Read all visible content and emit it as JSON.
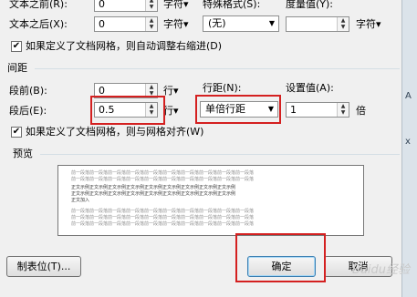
{
  "indent": {
    "before_label": "文本之前(R):",
    "before_value": "0",
    "before_unit": "字符▾",
    "after_label": "文本之后(X):",
    "after_value": "0",
    "after_unit": "字符▾",
    "special_label": "特殊格式(S):",
    "special_value": "(无)",
    "measure_label": "度量值(Y):",
    "measure_unit": "字符▾",
    "auto_adjust_label": "如果定义了文档网格，则自动调整右缩进(D)"
  },
  "spacing": {
    "section_title": "间距",
    "before_label": "段前(B):",
    "before_value": "0",
    "before_unit": "行▾",
    "after_label": "段后(E):",
    "after_value": "0.5",
    "after_unit": "行▾",
    "line_spacing_label": "行距(N):",
    "line_spacing_value": "单倍行距",
    "set_value_label": "设置值(A):",
    "set_value": "1",
    "set_value_unit": "倍",
    "snap_grid_label": "如果定义了文档网格，则与网格对齐(W)"
  },
  "preview": {
    "section_title": "预览",
    "gray_text": "前一段落前一段落前一段落前一段落前一段落前一段落前一段落前一段落前一段落前一段落",
    "sample_text": "正文示例正文示例正文示例正文示例正文示例正文示例正文示例正文示例正文示例",
    "short_text": "正文加入"
  },
  "buttons": {
    "tabs_label": "制表位(T)...",
    "ok_label": "确定",
    "cancel_label": "取消"
  },
  "side": {
    "mark_a": "A",
    "mark_b": "x"
  },
  "watermark": "Baidu经验"
}
